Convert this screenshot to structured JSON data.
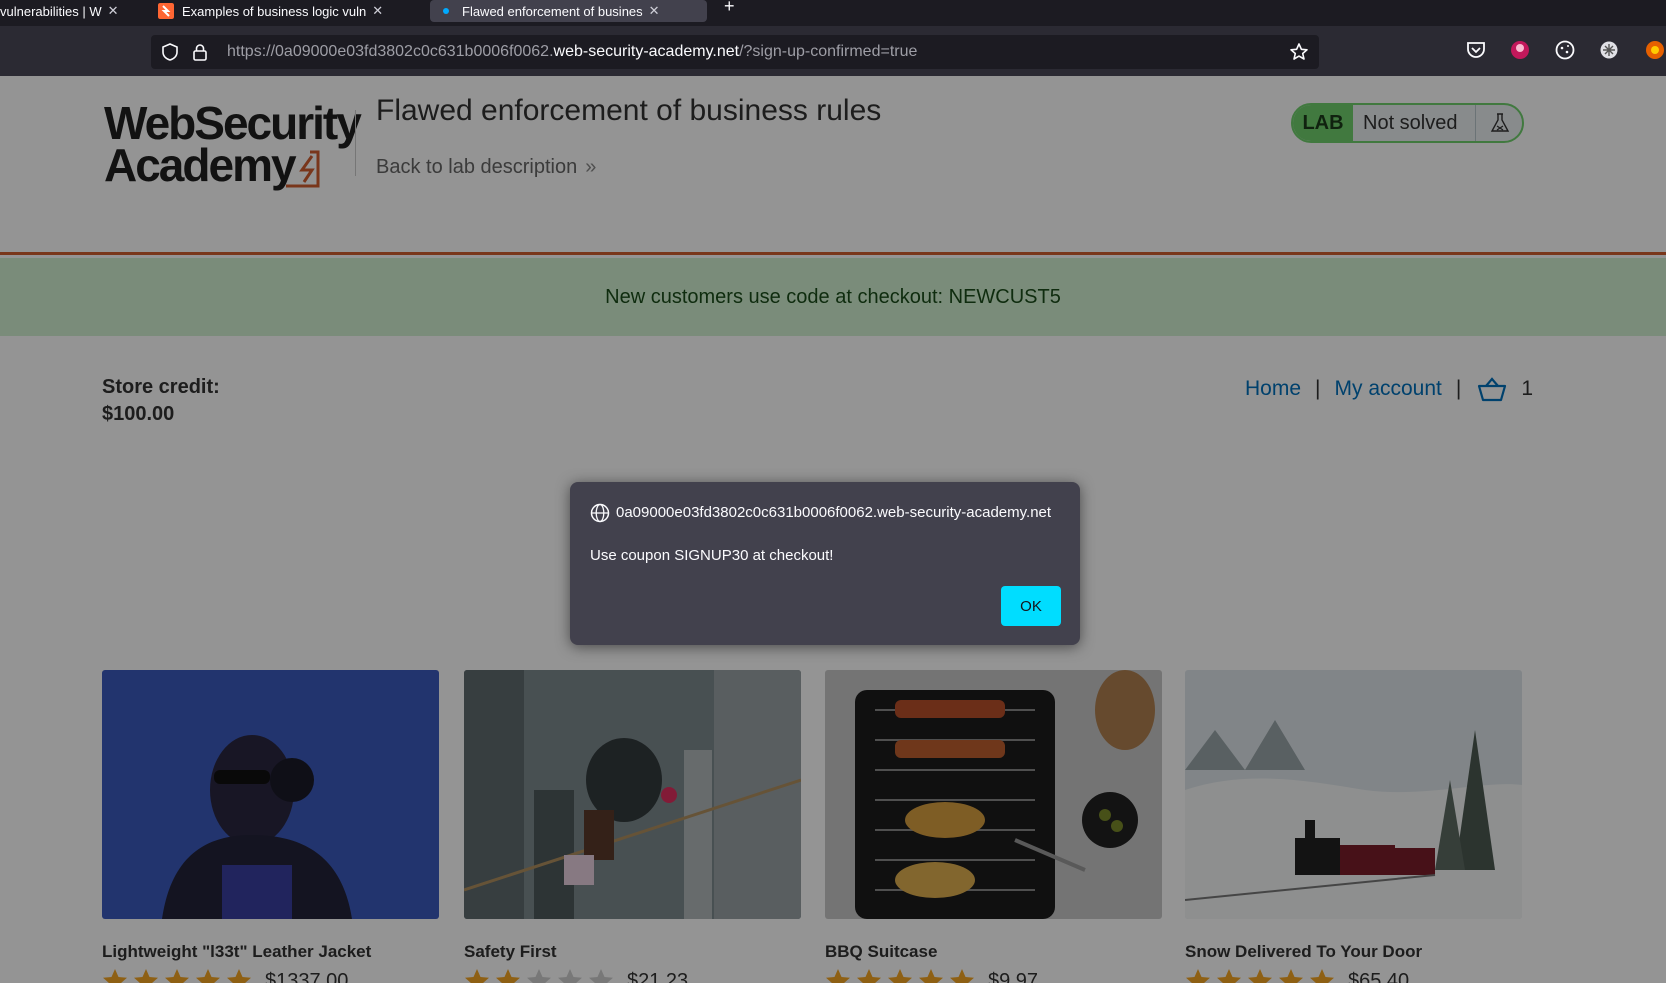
{
  "browser": {
    "tabs": [
      {
        "title": "vulnerabilities | W",
        "active": false
      },
      {
        "title": "Examples of business logic vuln",
        "active": false
      },
      {
        "title": "Flawed enforcement of busines",
        "active": true
      }
    ],
    "new_tab_label": "+",
    "url": {
      "prefix": "https://0a09000e03fd3802c0c631b0006f0062.",
      "host": "web-security-academy.net",
      "suffix": "/?sign-up-confirmed=true"
    }
  },
  "lab": {
    "logo_line1": "WebSecurity",
    "logo_line2": "Academy",
    "title": "Flawed enforcement of business rules",
    "back_link": "Back to lab description",
    "back_chevron": "»",
    "badge": "LAB",
    "status": "Not solved"
  },
  "notice": "New customers use code at checkout: NEWCUST5",
  "store_credit": {
    "label": "Store credit:",
    "value": "$100.00"
  },
  "nav": {
    "home": "Home",
    "account": "My account",
    "separator": "|",
    "cart_count": "1"
  },
  "products": [
    {
      "name": "Lightweight \"l33t\" Leather Jacket",
      "rating": 5,
      "price": "$1337.00"
    },
    {
      "name": "Safety First",
      "rating": 2,
      "price": "$21.23"
    },
    {
      "name": "BBQ Suitcase",
      "rating": 5,
      "price": "$9.97"
    },
    {
      "name": "Snow Delivered To Your Door",
      "rating": 5,
      "price": "$65.40"
    }
  ],
  "dialog": {
    "origin": "0a09000e03fd3802c0c631b0006f0062.web-security-academy.net",
    "message": "Use coupon SIGNUP30 at checkout!",
    "ok_label": "OK"
  },
  "colors": {
    "accent_orange": "#d05e2f",
    "lab_green": "#70d16d",
    "link_blue": "#0071bc",
    "star_gold": "#f5a623",
    "dialog_button": "#00ddff"
  }
}
